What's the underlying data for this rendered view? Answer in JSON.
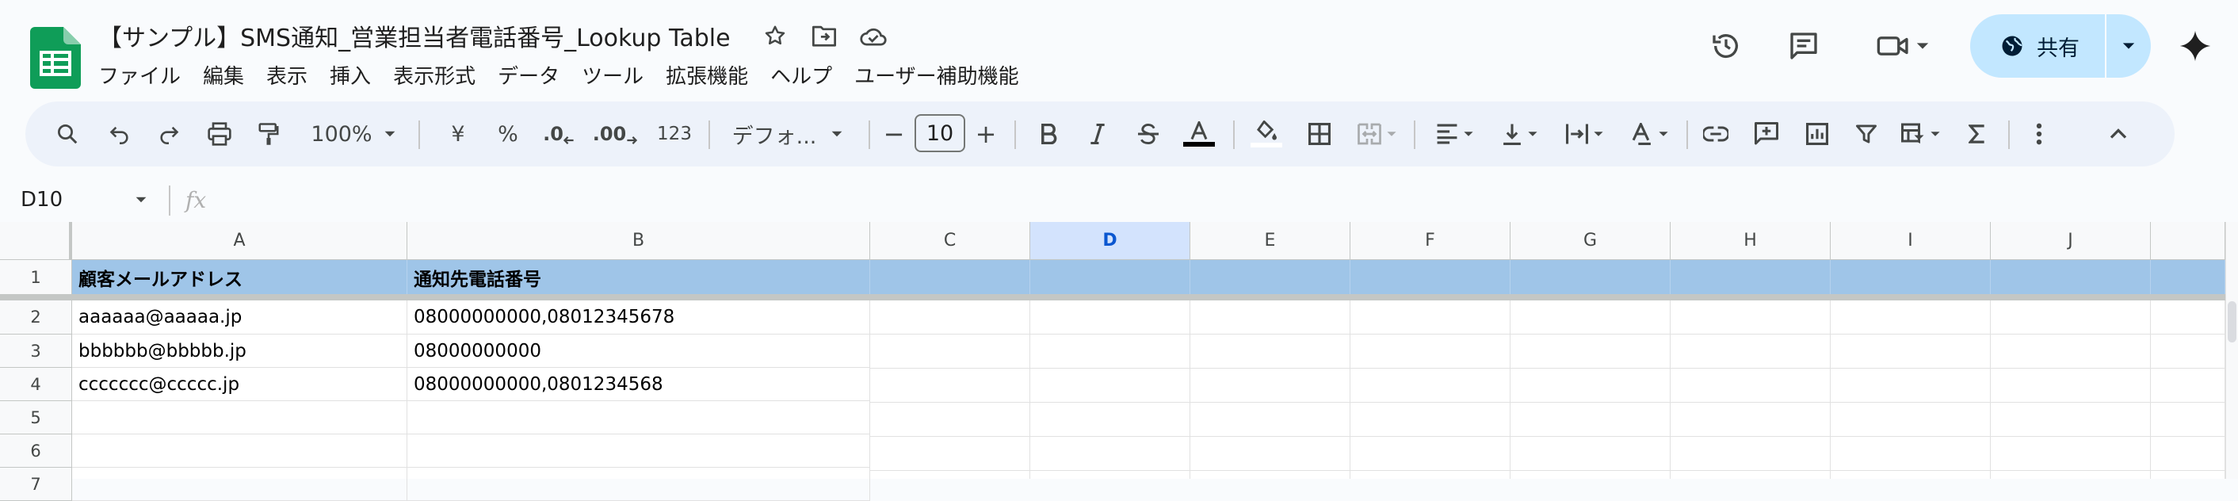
{
  "doc": {
    "title": "【サンプル】SMS通知_営業担当者電話番号_Lookup Table"
  },
  "menu": [
    "ファイル",
    "編集",
    "表示",
    "挿入",
    "表示形式",
    "データ",
    "ツール",
    "拡張機能",
    "ヘルプ",
    "ユーザー補助機能"
  ],
  "share": {
    "label": "共有"
  },
  "toolbar": {
    "zoom": "100%",
    "currency": "¥",
    "percent": "%",
    "dec_decrease": ".0",
    "dec_increase": ".00",
    "number_format": "123",
    "font": "デフォ...",
    "font_size": "10",
    "minus": "−",
    "plus": "+"
  },
  "formula_bar": {
    "name_box": "D10",
    "fx": "fx"
  },
  "sheet": {
    "columns": [
      "A",
      "B",
      "C",
      "D",
      "E",
      "F",
      "G",
      "H",
      "I",
      "J"
    ],
    "selected_column": "D",
    "rows": [
      {
        "num": "1",
        "cells": [
          "顧客メールアドレス",
          "通知先電話番号",
          "",
          "",
          "",
          "",
          "",
          "",
          "",
          ""
        ]
      },
      {
        "num": "2",
        "cells": [
          "aaaaaa@aaaaa.jp",
          "08000000000,08012345678",
          "",
          "",
          "",
          "",
          "",
          "",
          "",
          ""
        ]
      },
      {
        "num": "3",
        "cells": [
          "bbbbbb@bbbbb.jp",
          "08000000000",
          "",
          "",
          "",
          "",
          "",
          "",
          "",
          ""
        ]
      },
      {
        "num": "4",
        "cells": [
          "ccccccc@ccccc.jp",
          "08000000000,0801234568",
          "",
          "",
          "",
          "",
          "",
          "",
          "",
          ""
        ]
      },
      {
        "num": "5",
        "cells": [
          "",
          "",
          "",
          "",
          "",
          "",
          "",
          "",
          "",
          ""
        ]
      },
      {
        "num": "6",
        "cells": [
          "",
          "",
          "",
          "",
          "",
          "",
          "",
          "",
          "",
          ""
        ]
      },
      {
        "num": "7",
        "cells": [
          "",
          "",
          "",
          "",
          "",
          "",
          "",
          "",
          "",
          ""
        ]
      }
    ]
  },
  "colors": {
    "header_fill": "#9fc5e8",
    "selected_header": "#d3e3fd",
    "share_button": "#c2e7ff",
    "logo_green": "#0f9d58"
  }
}
